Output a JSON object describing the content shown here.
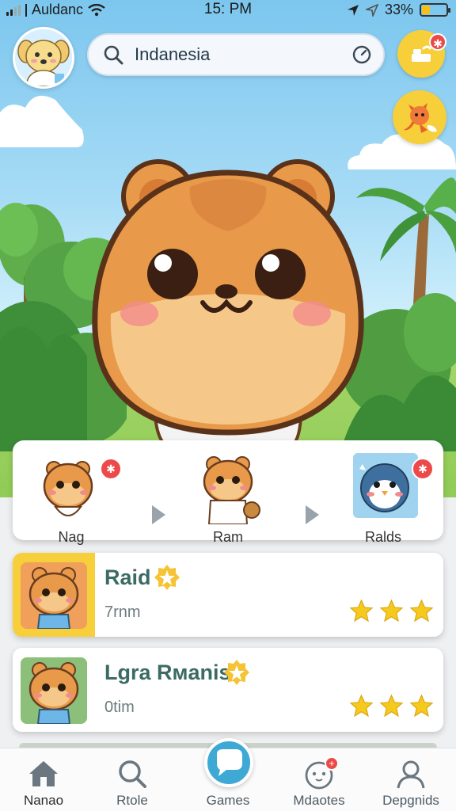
{
  "status_bar": {
    "carrier": "Auldanc",
    "time": "15: PM",
    "battery": "33%",
    "battery_level": 0.33
  },
  "search": {
    "value": "Indanesia",
    "placeholder": ""
  },
  "evolution": {
    "stages": [
      {
        "label": "Nag"
      },
      {
        "label": "Ram"
      },
      {
        "label": "Ralds"
      }
    ]
  },
  "games": [
    {
      "title": "Raid",
      "meta": "7rnm",
      "stars": 3,
      "highlight": true
    },
    {
      "title": "Lgra Rмanis",
      "meta": "0tim",
      "stars": 3,
      "highlight": false
    }
  ],
  "nav": {
    "items": [
      {
        "label": "Nanao",
        "icon": "home-icon",
        "active": true
      },
      {
        "label": "Rtole",
        "icon": "search-icon",
        "active": false
      },
      {
        "label": "Games",
        "icon": "chat-bubble-icon",
        "active": false
      },
      {
        "label": "Mdaotes",
        "icon": "pet-face-icon",
        "active": false
      },
      {
        "label": "Depgnids",
        "icon": "profile-icon",
        "active": false
      }
    ]
  },
  "colors": {
    "accent_yellow": "#f6cf3a",
    "title_green": "#3b6b63",
    "notif_red": "#ec4a4a",
    "games_blue": "#3fa9d6",
    "hamster_orange": "#e89a4a"
  }
}
